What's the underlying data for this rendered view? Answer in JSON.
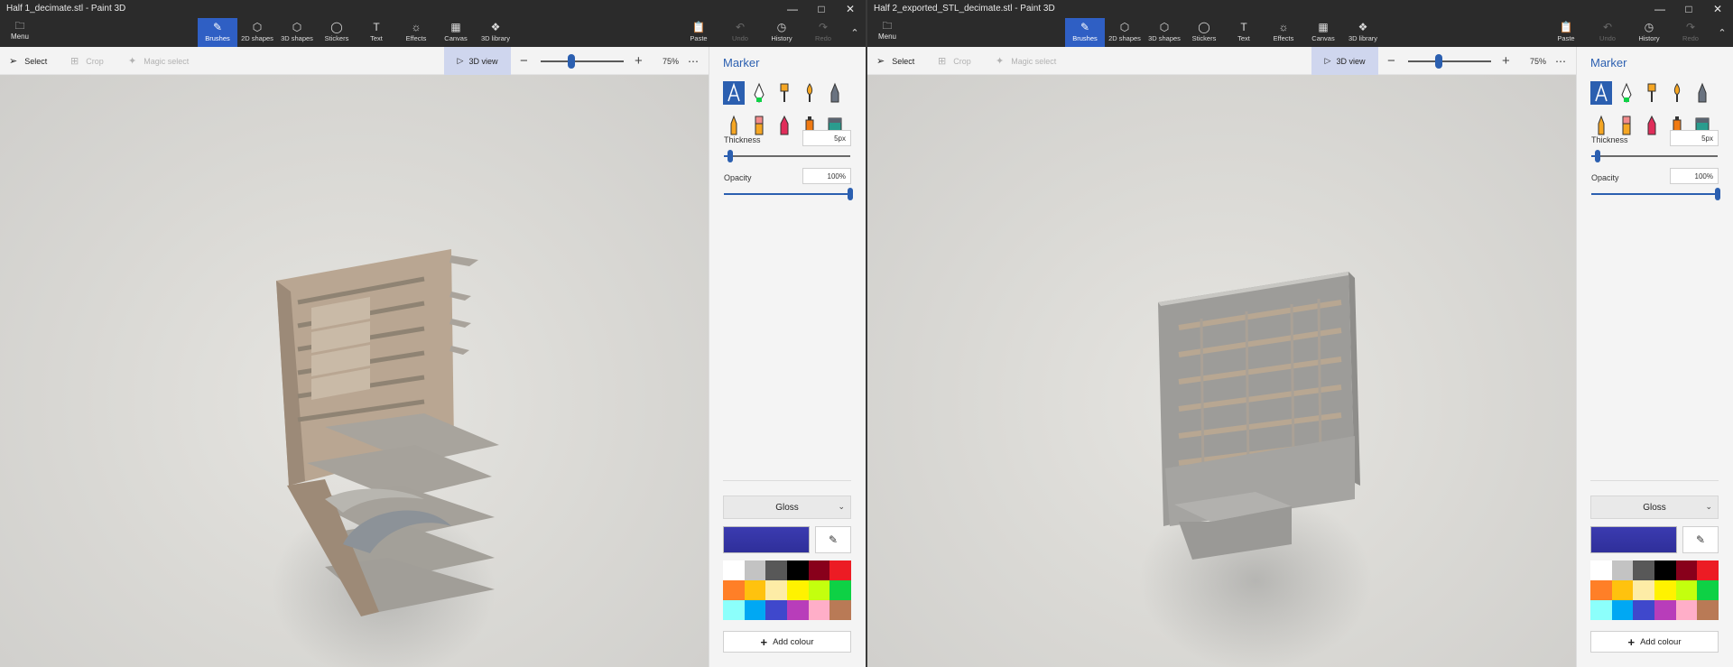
{
  "windows": [
    {
      "title": "Half 1_decimate.stl - Paint 3D",
      "zoom": "75%",
      "zoom_fraction": 0.36
    },
    {
      "title": "Half 2_exported_STL_decimate.stl - Paint 3D",
      "zoom": "75%",
      "zoom_fraction": 0.36
    }
  ],
  "ribbon": {
    "menu": "Menu",
    "tools": [
      "Brushes",
      "2D shapes",
      "3D shapes",
      "Stickers",
      "Text",
      "Effects",
      "Canvas",
      "3D library"
    ],
    "tool_icons": [
      "brush-icon",
      "2d-shapes-icon",
      "3d-shapes-icon",
      "stickers-icon",
      "text-icon",
      "effects-icon",
      "canvas-icon",
      "3d-library-icon"
    ],
    "active_tool": "Brushes",
    "paste": "Paste",
    "undo": "Undo",
    "history": "History",
    "redo": "Redo"
  },
  "subtoolbar": {
    "select": "Select",
    "crop": "Crop",
    "magic_select": "Magic select",
    "view3d": "3D view"
  },
  "panel": {
    "title": "Marker",
    "thickness_label": "Thickness",
    "thickness_value": "5px",
    "thickness_fraction": 0.05,
    "opacity_label": "Opacity",
    "opacity_value": "100%",
    "opacity_fraction": 1.0,
    "gloss": "Gloss",
    "current_color": "#3b3bb0",
    "add_colour": "Add colour",
    "brushes": [
      "marker",
      "calligraphy-pen",
      "oil-brush",
      "watercolor",
      "pixel-pen",
      "pencil",
      "eraser",
      "crayon",
      "spray-can",
      "fill"
    ],
    "palette": [
      "#ffffff",
      "#c3c3c3",
      "#585858",
      "#000000",
      "#88001b",
      "#ec1c24",
      "#ff7f27",
      "#ffc20e",
      "#fdeca6",
      "#fff200",
      "#c4ff0e",
      "#0ed145",
      "#8cfffb",
      "#00a8f3",
      "#3f48cc",
      "#b83dba",
      "#ffaec8",
      "#b97a56"
    ]
  },
  "colors": {
    "accent": "#2b5fb0",
    "titlebar": "#2b2b2b",
    "building": "#b4a38f"
  }
}
